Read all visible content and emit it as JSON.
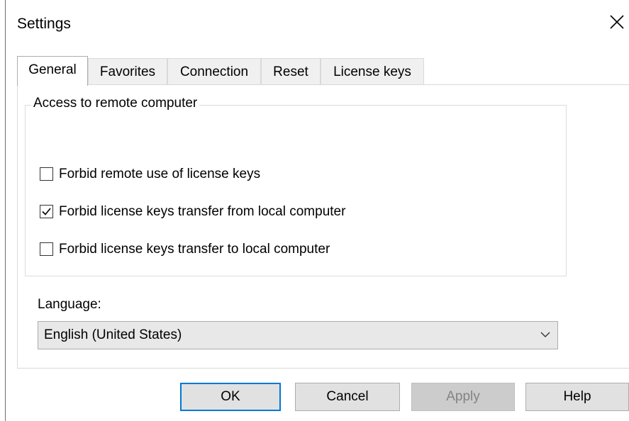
{
  "window": {
    "title": "Settings"
  },
  "tabs": [
    {
      "label": "General",
      "active": true
    },
    {
      "label": "Favorites",
      "active": false
    },
    {
      "label": "Connection",
      "active": false
    },
    {
      "label": "Reset",
      "active": false
    },
    {
      "label": "License keys",
      "active": false
    }
  ],
  "group": {
    "legend": "Access to remote computer",
    "options": [
      {
        "label": "Forbid remote use of license keys",
        "checked": false
      },
      {
        "label": "Forbid license keys transfer from local computer",
        "checked": true
      },
      {
        "label": "Forbid license keys transfer to local computer",
        "checked": false
      }
    ]
  },
  "language": {
    "label": "Language:",
    "value": "English (United States)"
  },
  "buttons": {
    "ok": "OK",
    "cancel": "Cancel",
    "apply": "Apply",
    "help": "Help"
  },
  "colors": {
    "focus_border": "#0078d7",
    "disabled_text": "#838383"
  }
}
